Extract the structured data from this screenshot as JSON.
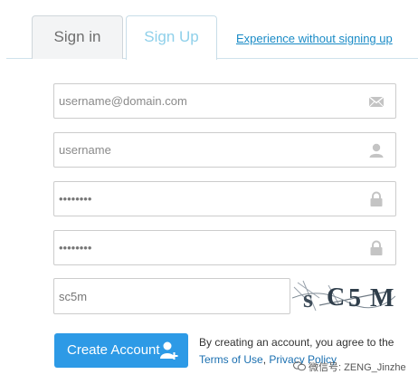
{
  "tabs": [
    {
      "label": "Sign in",
      "active": false
    },
    {
      "label": "Sign Up",
      "active": true
    }
  ],
  "experience_link": "Experience without signing up",
  "fields": {
    "email": {
      "placeholder": "username@domain.com",
      "icon": "envelope-icon"
    },
    "username": {
      "placeholder": "username",
      "icon": "user-icon"
    },
    "password": {
      "value": "••••••••",
      "icon": "lock-icon"
    },
    "confirm_password": {
      "value": "••••••••",
      "icon": "lock-icon"
    },
    "captcha": {
      "value": "sc5m"
    }
  },
  "captcha_image_text": "sC5M",
  "create_button": {
    "label": "Create Account",
    "icon": "add-user-icon"
  },
  "terms": {
    "prefix": "By creating an account, you agree to the",
    "terms_link": "Terms of Use",
    "separator": ", ",
    "privacy_link": "Privacy Policy"
  },
  "watermark": "微信号: ZENG_Jinzhe",
  "colors": {
    "accent": "#2d9ae6",
    "link": "#1a8bc6",
    "tab_active_text": "#8fd0ea"
  }
}
